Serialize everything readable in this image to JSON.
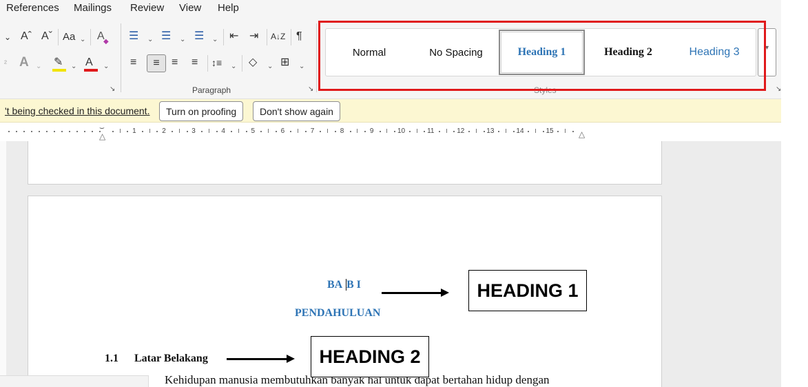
{
  "menu": [
    "References",
    "Mailings",
    "Review",
    "View",
    "Help"
  ],
  "font_group": {
    "grow_font": "Aˆ",
    "shrink_font": "Aˇ",
    "change_case": "Aa",
    "clear_format": "A",
    "text_effects": "A",
    "highlight": "✎",
    "font_color": "A"
  },
  "paragraph_group": {
    "label": "Paragraph",
    "bullets": "☰",
    "numbering": "☰",
    "multilevel": "☰",
    "decrease_indent": "⇤",
    "increase_indent": "⇥",
    "sort": "A↓Z",
    "pilcrow": "¶",
    "align_left": "≡",
    "align_center": "≡",
    "align_right": "≡",
    "justify": "≡",
    "line_spacing": "↕≡",
    "shading": "◇",
    "borders": "⊞"
  },
  "styles_group": {
    "label": "Styles",
    "items": [
      "Normal",
      "No Spacing",
      "Heading 1",
      "Heading 2",
      "Heading 3"
    ],
    "selected": "Heading 1",
    "highlight_color": "#e0191b"
  },
  "message_bar": {
    "text": "'t being checked in this document.",
    "button_turn_on": "Turn on proofing",
    "button_dont_show": "Don't show again"
  },
  "ruler": {
    "numbers": [
      "1",
      "2",
      "3",
      "4",
      "5",
      "6",
      "7",
      "8",
      "9",
      "10",
      "11",
      "12",
      "13",
      "14",
      "15"
    ]
  },
  "document": {
    "heading1_line1_a": "BA",
    "heading1_line1_b": "B I",
    "heading1_line2": "PENDAHULUAN",
    "heading2_number": "1.1",
    "heading2_text": "Latar Belakang",
    "body_text": "Kehidupan manusia membutuhkan banyak hal untuk dapat bertahan hidup dengan"
  },
  "annotations": {
    "callout_heading1": "HEADING 1",
    "callout_heading2": "HEADING 2"
  },
  "colors": {
    "heading_blue": "#2e74b5",
    "message_bar_bg": "#fcf7d2",
    "ribbon_bg": "#f5f5f5"
  }
}
